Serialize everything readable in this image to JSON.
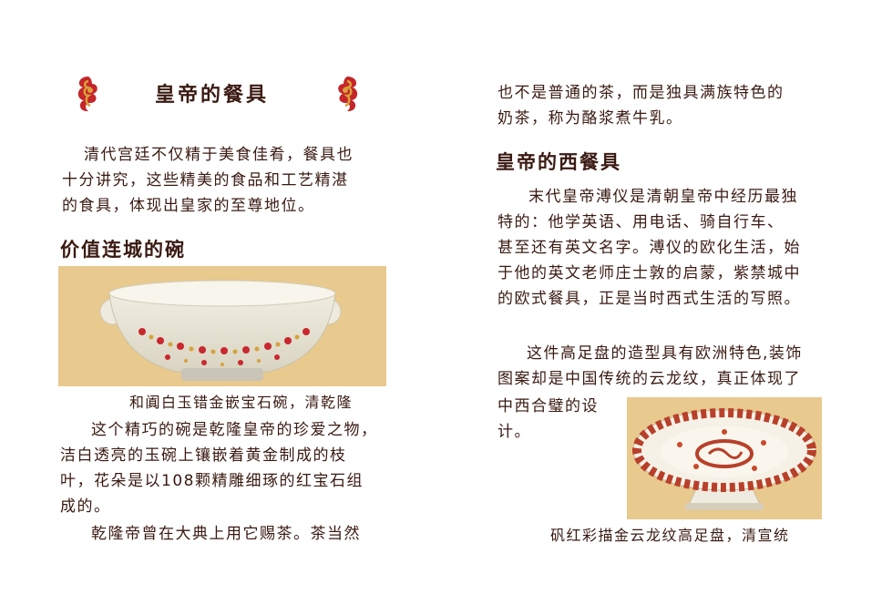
{
  "left": {
    "title": "皇帝的餐具",
    "intro": [
      "清代宫廷不仅精于美食佳肴，餐具也",
      "十分讲究，这些精美的食品和工艺精湛",
      "的食具，体现出皇家的至尊地位。"
    ],
    "section_heading": "价值连城的碗",
    "bowl_caption": "和阗白玉错金嵌宝石碗，清乾隆",
    "bowl_desc": [
      "这个精巧的碗是乾隆皇帝的珍爱之物，",
      "洁白透亮的玉碗上镶嵌着黄金制成的枝",
      "叶，花朵是以108颗精雕细琢的红宝石组",
      "成的。"
    ],
    "tea_line": "乾隆帝曾在大典上用它赐茶。茶当然"
  },
  "right": {
    "tea_cont": [
      "也不是普通的茶，而是独具满族特色的",
      "奶茶，称为酪浆煮牛乳。"
    ],
    "section_heading": "皇帝的西餐具",
    "western_desc": [
      "末代皇帝溥仪是清朝皇帝中经历最独",
      "特的：他学英语、用电话、骑自行车、",
      "甚至还有英文名字。溥仪的欧化生活，始",
      "于他的英文老师庄士敦的启蒙，紫禁城中",
      "的欧式餐具，正是当时西式生活的写照。"
    ],
    "plate_desc": [
      "这件高足盘的造型具有欧洲特色,装饰",
      "图案却是中国传统的云龙纹，真正体现了",
      "中西合璧的设",
      "计。"
    ],
    "plate_caption": "矾红彩描金云龙纹高足盘，清宣统"
  },
  "colors": {
    "ornament_red": "#c4262a",
    "ornament_gold": "#d9a23a",
    "photo_bg": "#e8c98e"
  },
  "icons": {
    "left_ornament": "cloud-scroll-ornament-icon",
    "right_ornament": "cloud-scroll-ornament-icon"
  }
}
